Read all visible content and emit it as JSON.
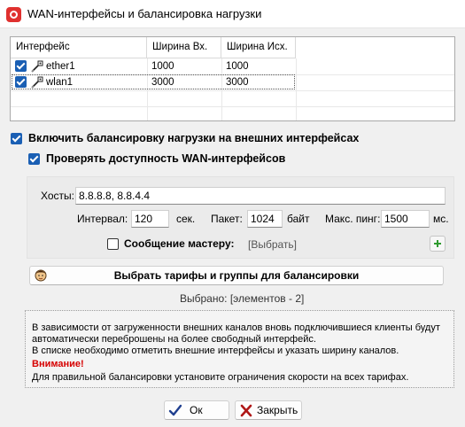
{
  "window": {
    "title": "WAN-интерфейсы и балансировка нагрузки",
    "icon": "app-logo-icon"
  },
  "interfaces_table": {
    "columns": [
      "Интерфейс",
      "Ширина Вх.",
      "Ширина Исх."
    ],
    "rows": [
      {
        "name": "ether1",
        "checked": true,
        "in": "1000",
        "out": "1000",
        "icon": "network-cable-icon"
      },
      {
        "name": "wlan1",
        "checked": true,
        "in": "3000",
        "out": "3000",
        "icon": "network-cable-icon"
      }
    ]
  },
  "enable_balancing": {
    "label": "Включить балансировку нагрузки на внешних интерфейсах",
    "checked": true
  },
  "check_wan": {
    "label": "Проверять доступность WAN-интерфейсов",
    "checked": true
  },
  "hosts": {
    "label": "Хосты:",
    "value": "8.8.8.8, 8.8.4.4"
  },
  "interval": {
    "label": "Интервал:",
    "value": "120",
    "unit": "сек."
  },
  "packet": {
    "label": "Пакет:",
    "value": "1024",
    "unit": "байт"
  },
  "max_ping": {
    "label": "Макс. пинг:",
    "value": "1500",
    "unit": "мс."
  },
  "master_message": {
    "label": "Сообщение мастеру:",
    "checked": false,
    "choose": "[Выбрать]"
  },
  "select_tariffs_button": {
    "label": "Выбрать тарифы и группы для балансировки",
    "icon": "user-face-icon"
  },
  "selected_count": {
    "text": "Выбрано:  [элементов - 2]"
  },
  "info": {
    "line1": "В зависимости от загруженности внешних каналов вновь подключившиеся клиенты  будут",
    "line2": "автоматически переброшены на более свободный интерфейс.",
    "line3": "В списке необходимо отметить внешние интерфейсы и указать ширину каналов.",
    "warning": "Внимание!",
    "line4": "Для правильной балансировки установите ограничения скорости на всех тарифах."
  },
  "buttons": {
    "ok": {
      "label": "Ок",
      "icon": "checkmark-icon"
    },
    "close": {
      "label": "Закрыть",
      "icon": "close-x-icon"
    }
  },
  "colors": {
    "checkbox": "#1a5fb4",
    "warning": "#d60000",
    "accent_icon": "#e0312f",
    "plus": "#2e9b2e"
  }
}
